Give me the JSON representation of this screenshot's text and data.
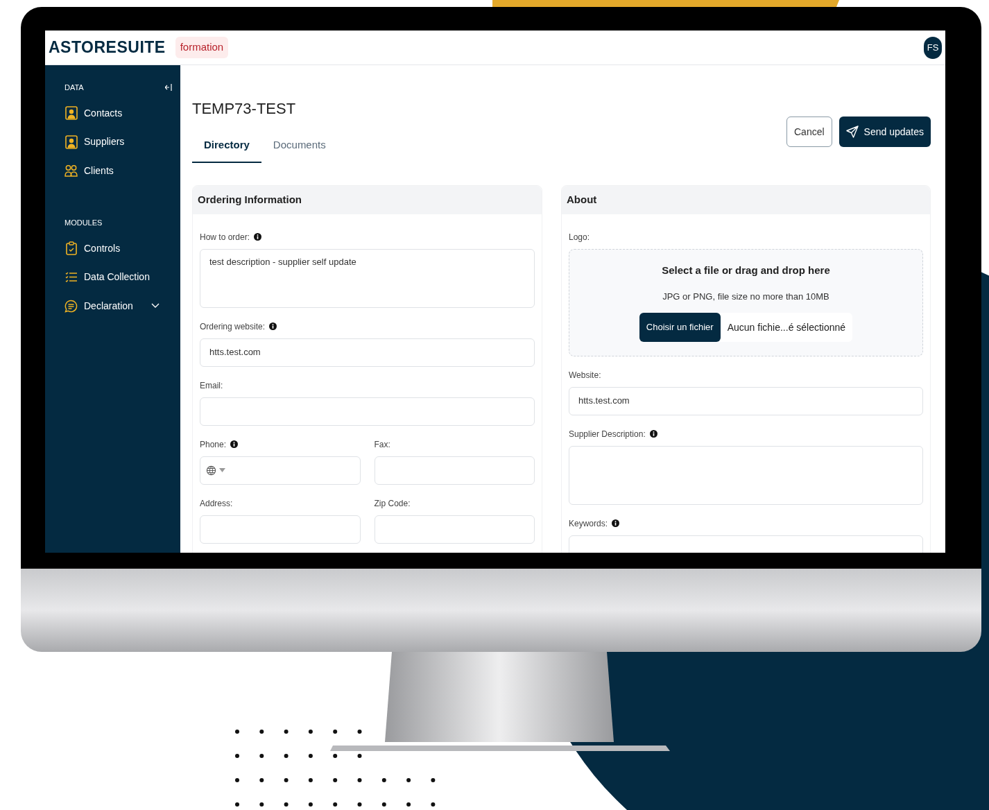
{
  "app": {
    "logo": "ASTORESUITE",
    "environment_badge": "formation",
    "user_initials": "FS"
  },
  "sidebar": {
    "sections": [
      {
        "title": "DATA",
        "items": [
          {
            "label": "Contacts",
            "kind": "card"
          },
          {
            "label": "Suppliers",
            "kind": "card"
          },
          {
            "label": "Clients",
            "kind": "people"
          }
        ]
      },
      {
        "title": "MODULES",
        "items": [
          {
            "label": "Controls",
            "kind": "clipboard"
          },
          {
            "label": "Data Collection",
            "kind": "list"
          },
          {
            "label": "Declaration",
            "kind": "chat",
            "expanded": false
          }
        ]
      }
    ]
  },
  "page": {
    "title": "TEMP73-TEST",
    "actions": [
      {
        "label": "Cancel",
        "kind": "outline"
      },
      {
        "label": "Send updates",
        "kind": "primary"
      }
    ],
    "tabs": [
      {
        "label": "Directory",
        "selected": true
      },
      {
        "label": "Documents",
        "selected": false
      }
    ]
  },
  "panels": [
    {
      "title": "Ordering Information",
      "rows": [
        [
          {
            "label": "How to order:",
            "info": true,
            "kind": "textarea",
            "value": "test description - supplier self update"
          }
        ],
        [
          {
            "label": "Ordering website:",
            "info": true,
            "kind": "text",
            "value": "htts.test.com"
          }
        ],
        [
          {
            "label": "Email:",
            "info": false,
            "kind": "text"
          }
        ],
        [
          {
            "label": "Phone:",
            "info": true,
            "kind": "phone"
          },
          {
            "label": "Fax:",
            "info": false,
            "kind": "text"
          }
        ],
        [
          {
            "label": "Address:",
            "info": false,
            "kind": "text"
          },
          {
            "label": "Zip Code:",
            "info": false,
            "kind": "text"
          }
        ]
      ]
    },
    {
      "title": "About",
      "rows": [
        [
          {
            "label": "Logo:",
            "info": false,
            "kind": "upload",
            "heading": "Select a file or drag and drop here",
            "hint": "JPG or PNG, file size no more than 10MB",
            "button": "Choisir un fichier",
            "file_status": "Aucun fichie...é sélectionné"
          }
        ],
        [
          {
            "label": "Website:",
            "info": false,
            "kind": "text",
            "value": "htts.test.com"
          }
        ],
        [
          {
            "label": "Supplier Description:",
            "info": true,
            "kind": "textarea"
          }
        ],
        [
          {
            "label": "Keywords:",
            "info": true,
            "kind": "text"
          }
        ]
      ]
    }
  ]
}
